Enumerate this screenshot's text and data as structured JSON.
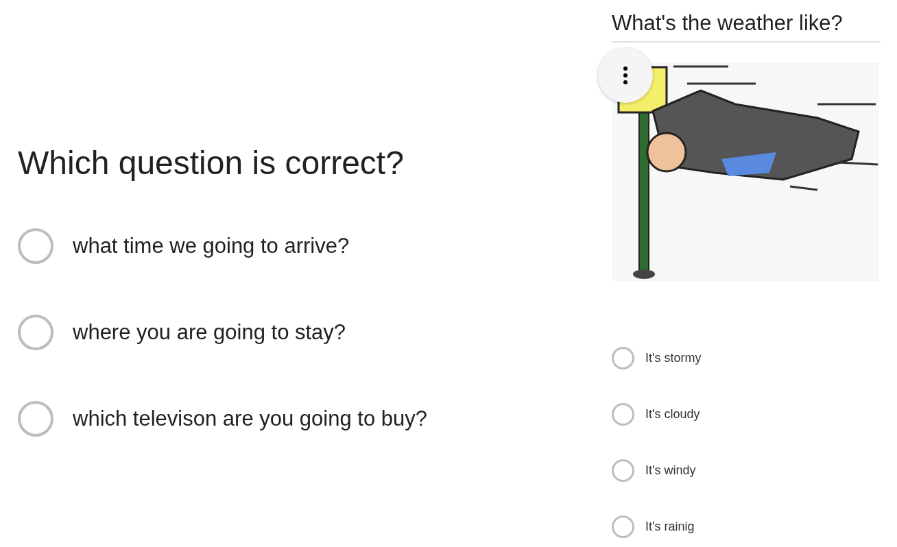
{
  "question_1": {
    "title": "Which question is correct?",
    "options": [
      {
        "label": "what time we going to arrive?",
        "selected": false
      },
      {
        "label": "where you are going to stay?",
        "selected": false
      },
      {
        "label": "which televison are you going to buy?",
        "selected": false
      }
    ]
  },
  "question_2": {
    "title": "What's the weather like?",
    "options": [
      {
        "label": "It's stormy",
        "selected": false
      },
      {
        "label": "It's cloudy",
        "selected": false
      },
      {
        "label": "It's windy",
        "selected": false
      },
      {
        "label": "It's rainig",
        "selected": false
      }
    ]
  }
}
